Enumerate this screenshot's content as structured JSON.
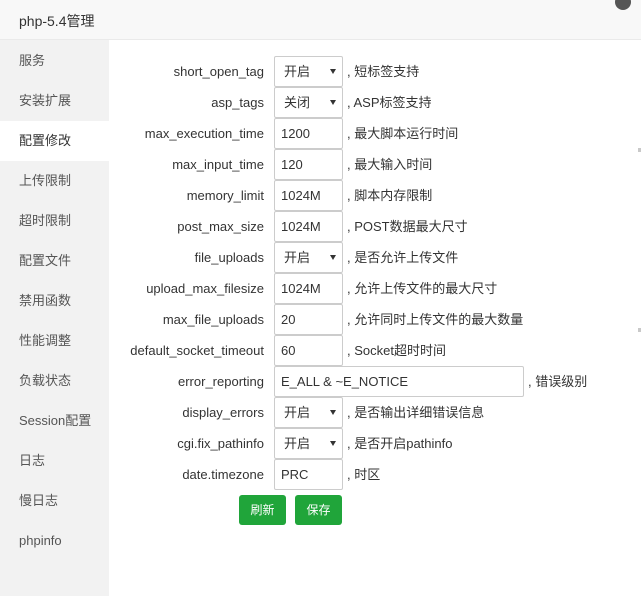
{
  "window": {
    "title": "php-5.4管理"
  },
  "sidebar": {
    "items": [
      {
        "label": "服务"
      },
      {
        "label": "安装扩展"
      },
      {
        "label": "配置修改"
      },
      {
        "label": "上传限制"
      },
      {
        "label": "超时限制"
      },
      {
        "label": "配置文件"
      },
      {
        "label": "禁用函数"
      },
      {
        "label": "性能调整"
      },
      {
        "label": "负载状态"
      },
      {
        "label": "Session配置"
      },
      {
        "label": "日志"
      },
      {
        "label": "慢日志"
      },
      {
        "label": "phpinfo"
      }
    ],
    "active_index": 2
  },
  "settings": [
    {
      "label": "short_open_tag",
      "type": "select",
      "value": "开启",
      "desc": ", 短标签支持"
    },
    {
      "label": "asp_tags",
      "type": "select",
      "value": "关闭",
      "desc": ", ASP标签支持"
    },
    {
      "label": "max_execution_time",
      "type": "input",
      "value": "1200",
      "desc": ", 最大脚本运行时间"
    },
    {
      "label": "max_input_time",
      "type": "input",
      "value": "120",
      "desc": ", 最大输入时间"
    },
    {
      "label": "memory_limit",
      "type": "input",
      "value": "1024M",
      "desc": ", 脚本内存限制"
    },
    {
      "label": "post_max_size",
      "type": "input",
      "value": "1024M",
      "desc": ", POST数据最大尺寸"
    },
    {
      "label": "file_uploads",
      "type": "select",
      "value": "开启",
      "desc": ", 是否允许上传文件"
    },
    {
      "label": "upload_max_filesize",
      "type": "input",
      "value": "1024M",
      "desc": ", 允许上传文件的最大尺寸"
    },
    {
      "label": "max_file_uploads",
      "type": "input",
      "value": "20",
      "desc": ", 允许同时上传文件的最大数量"
    },
    {
      "label": "default_socket_timeout",
      "type": "input",
      "value": "60",
      "desc": ", Socket超时时间"
    },
    {
      "label": "error_reporting",
      "type": "input",
      "value": "E_ALL & ~E_NOTICE",
      "desc": ", 错误级别"
    },
    {
      "label": "display_errors",
      "type": "select",
      "value": "开启",
      "desc": ", 是否输出详细错误信息"
    },
    {
      "label": "cgi.fix_pathinfo",
      "type": "select",
      "value": "开启",
      "desc": ", 是否开启pathinfo"
    },
    {
      "label": "date.timezone",
      "type": "input",
      "value": "PRC",
      "desc": ", 时区"
    }
  ],
  "buttons": {
    "refresh_label": "刷新",
    "save_label": "保存"
  },
  "colors": {
    "accent": "#20a53a",
    "sidebar_bg": "#f2f2f2"
  },
  "icons": {
    "close": "close-icon",
    "caret": "chevron-down-icon"
  }
}
